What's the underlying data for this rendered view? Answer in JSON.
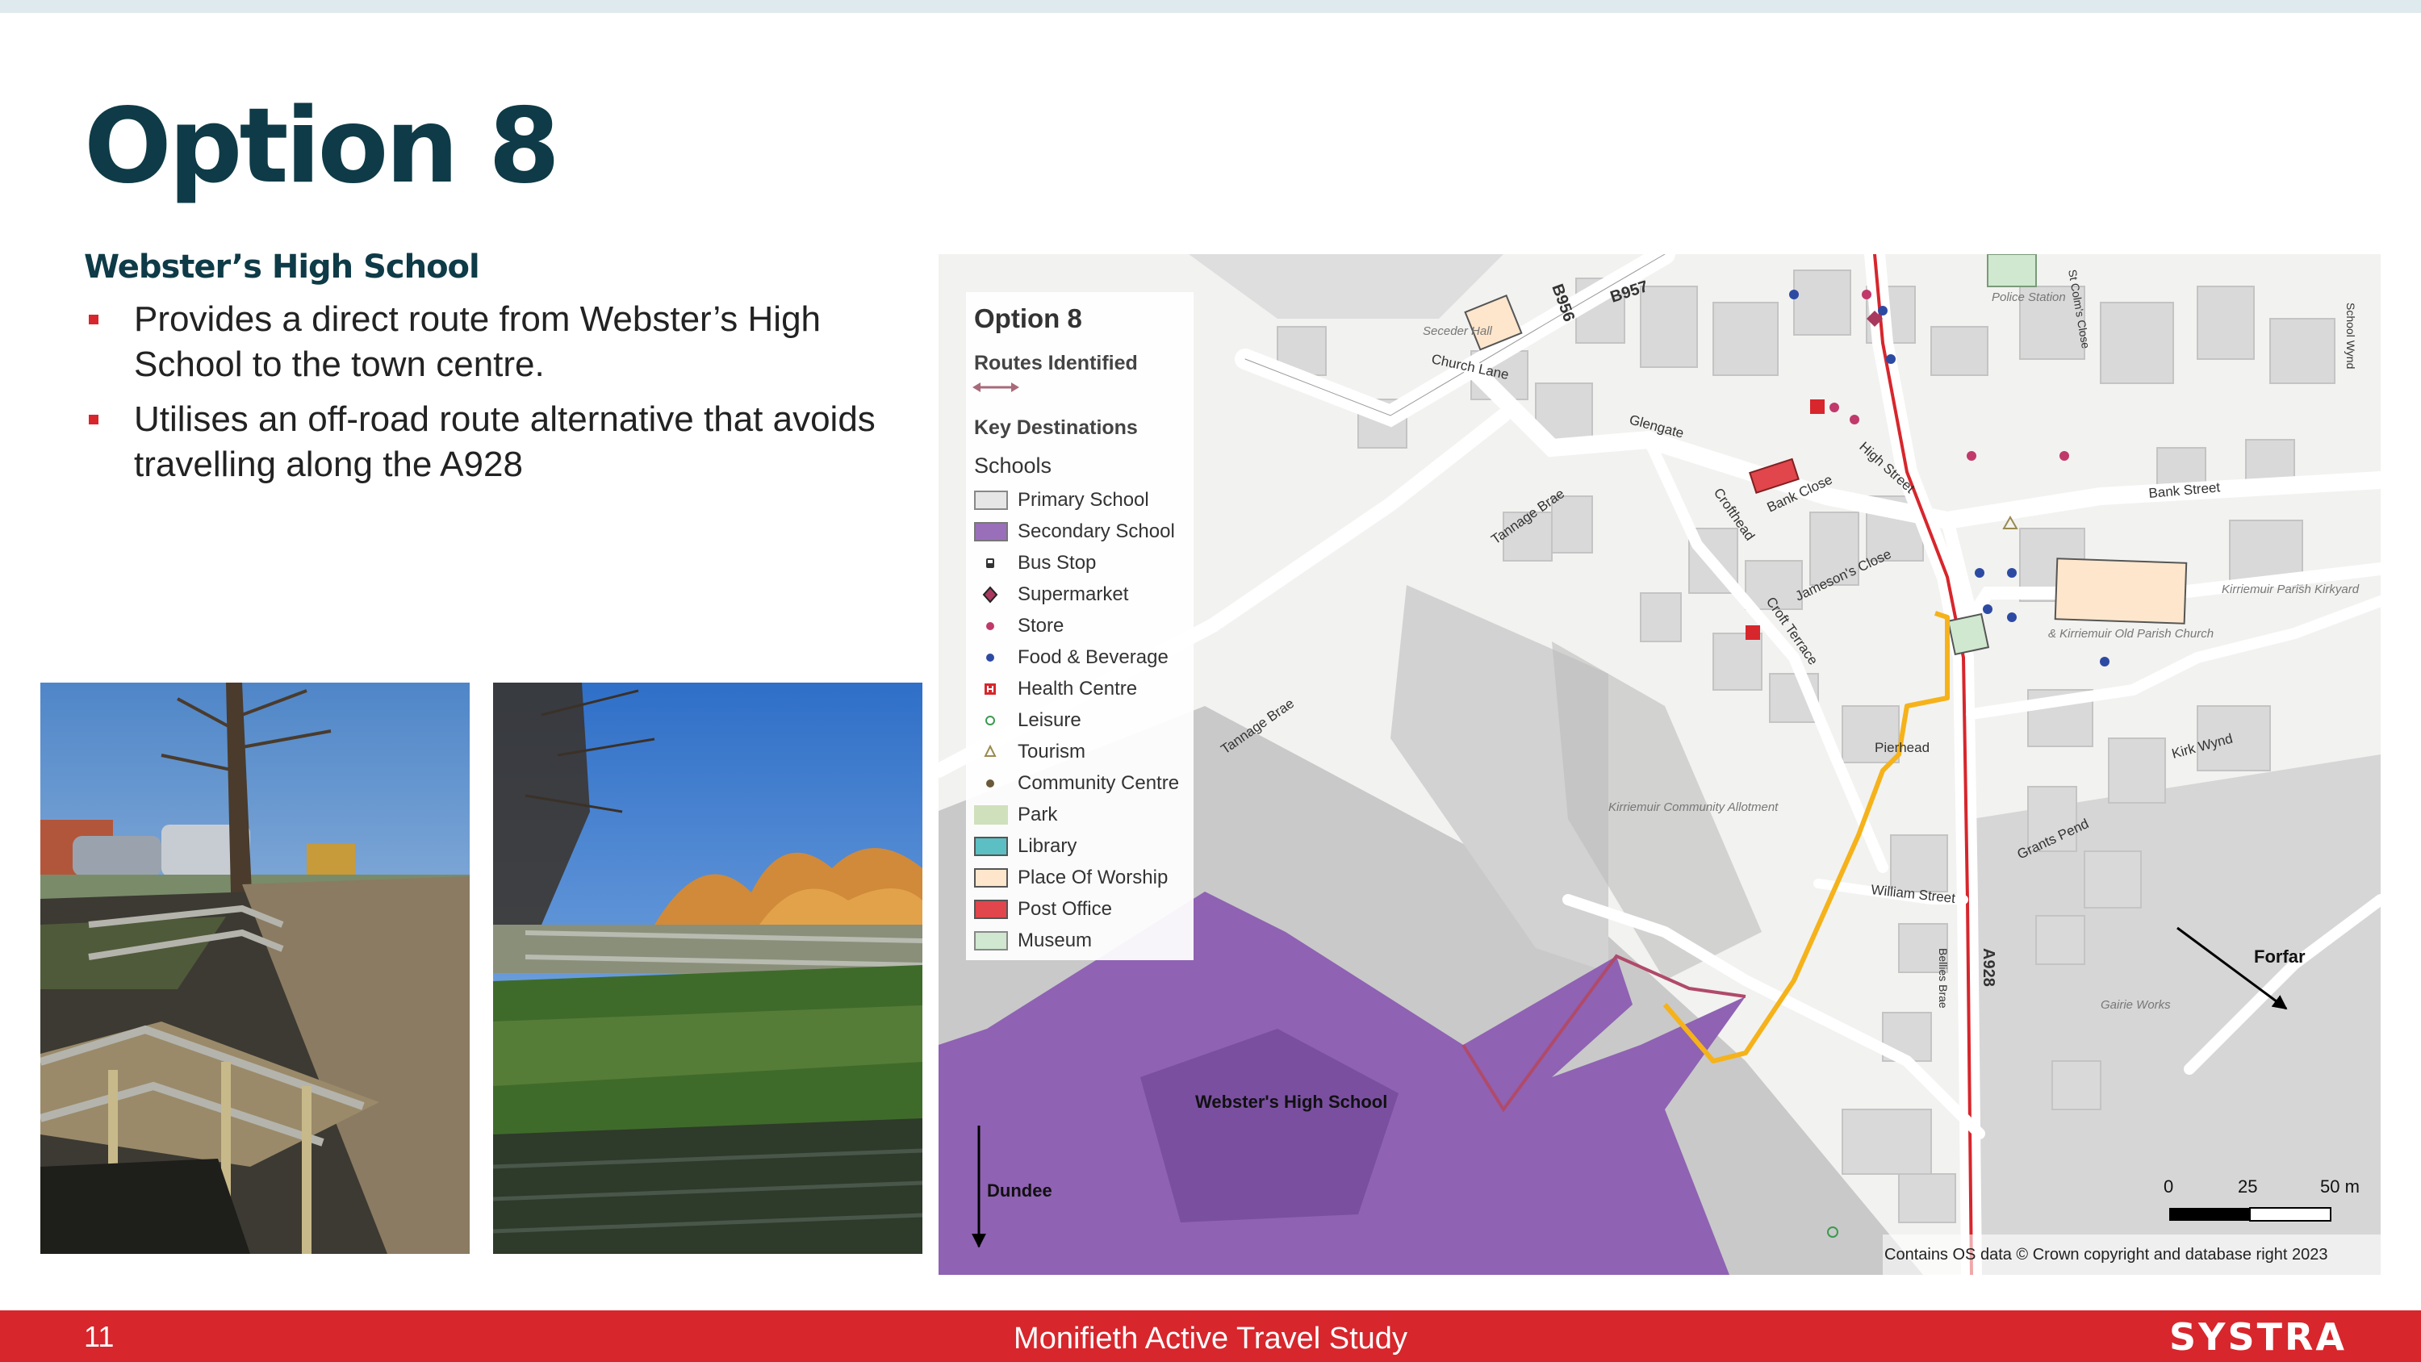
{
  "slide": {
    "title": "Option 8",
    "subtitle": "Webster’s High School",
    "bullets": [
      "Provides a direct route from Webster’s High School to the town centre.",
      "Utilises an off-road route alternative that avoids travelling along the A928"
    ]
  },
  "map": {
    "legend": {
      "title": "Option 8",
      "routes_heading": "Routes Identified",
      "key_heading": "Key Destinations",
      "schools_heading": "Schools",
      "items": [
        {
          "label": "Primary School",
          "icon": "primary-school-swatch",
          "color": "#e6e6e6"
        },
        {
          "label": "Secondary School",
          "icon": "secondary-school-swatch",
          "color": "#9a6fba"
        },
        {
          "label": "Bus Stop",
          "icon": "bus-stop-icon",
          "color": "#333333"
        },
        {
          "label": "Supermarket",
          "icon": "supermarket-icon",
          "color": "#a8385e"
        },
        {
          "label": "Store",
          "icon": "store-icon",
          "color": "#c0396a"
        },
        {
          "label": "Food & Beverage",
          "icon": "food-beverage-icon",
          "color": "#2d4aa3"
        },
        {
          "label": "Health Centre",
          "icon": "health-centre-icon",
          "color": "#d7262c"
        },
        {
          "label": "Leisure",
          "icon": "leisure-icon",
          "color": "#3a9a50"
        },
        {
          "label": "Tourism",
          "icon": "tourism-icon",
          "color": "#9a8a50"
        },
        {
          "label": "Community Centre",
          "icon": "community-centre-icon",
          "color": "#6a5a3a"
        },
        {
          "label": "Park",
          "icon": "park-swatch",
          "color": "#cfe0bc"
        },
        {
          "label": "Library",
          "icon": "library-swatch",
          "color": "#5bbfc4"
        },
        {
          "label": "Place Of Worship",
          "icon": "place-of-worship-swatch",
          "color": "#fde6cc"
        },
        {
          "label": "Post Office",
          "icon": "post-office-swatch",
          "color": "#e0464c"
        },
        {
          "label": "Museum",
          "icon": "museum-swatch",
          "color": "#cfe8cf"
        }
      ]
    },
    "labels": {
      "school": "Webster's High School",
      "forfar": "Forfar",
      "dundee": "Dundee",
      "attribution": "Contains OS data © Crown copyright and database right 2023",
      "scale": [
        "0",
        "25",
        "50 m"
      ],
      "roads": {
        "b956": "B956",
        "b957": "B957",
        "a928": "A928",
        "glengate": "Glengate",
        "high_street": "High Street",
        "bank_street": "Bank Street",
        "tannage_brae_upper": "Tannage Brae",
        "tannage_brae_lower": "Tannage Brae",
        "church_lane": "Church Lane",
        "crofthead": "Crofthead",
        "croft_terrace": "Croft Terrace",
        "jamesons_close": "Jameson's Close",
        "william_street": "William Street",
        "kirk_wynd": "Kirk Wynd",
        "bellies_brae": "Bellies Brae",
        "pierhead": "Pierhead",
        "grants_pend": "Grants Pend",
        "bank_close": "Bank Close",
        "st_colms_close": "St Colm's Close",
        "school_wynd": "School Wynd"
      },
      "places": {
        "allotment": "Kirriemuir Community Allotment",
        "gairie_works": "Gairie Works",
        "kirkyard": "Kirriemuir Parish Kirkyard",
        "parish_church": "& Kirriemuir Old Parish Church",
        "police": "Police Station",
        "seceder_hall": "Seceder Hall"
      }
    },
    "colors": {
      "route": "#f5b21a",
      "school": "#8f62b3",
      "background": "#f2f2f0",
      "building": "#d9d9d9",
      "grey_area": "#c9c9c9"
    }
  },
  "footer": {
    "page_number": "11",
    "title": "Monifieth Active Travel Study",
    "brand": "SYSTRA"
  }
}
